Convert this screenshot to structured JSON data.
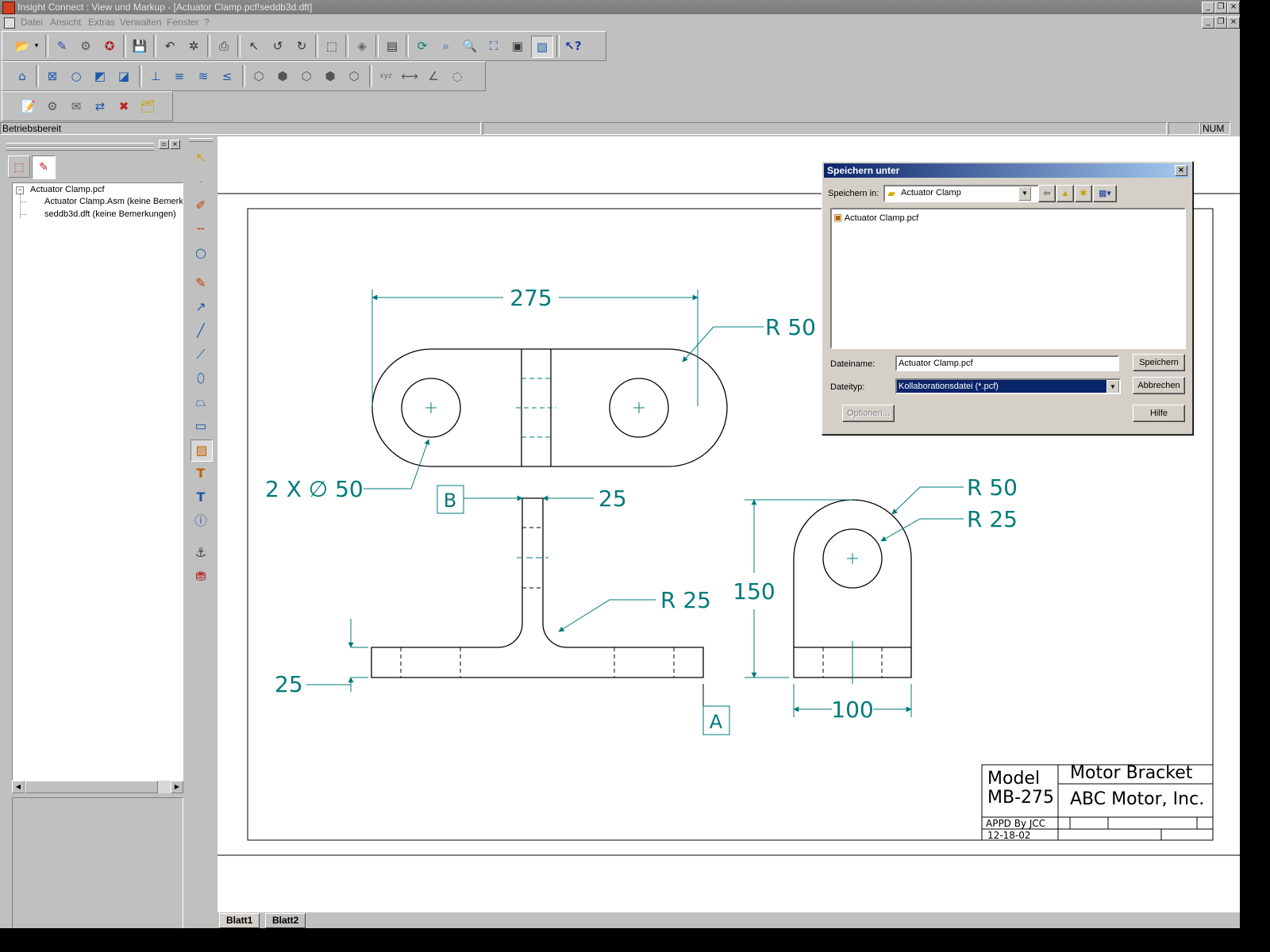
{
  "window": {
    "title": "Insight Connect : View und Markup - [Actuator Clamp.pcf!seddb3d.dft]"
  },
  "menu": [
    "Datei",
    "Ansicht",
    "Extras",
    "Verwalten",
    "Fenster",
    "?"
  ],
  "status": {
    "text": "Betriebsbereit",
    "num": "NUM"
  },
  "tree": {
    "root": "Actuator Clamp.pcf",
    "children": [
      "Actuator Clamp.Asm (keine Bemerkungen)",
      "seddb3d.dft (keine Bemerkungen)"
    ]
  },
  "sheet_tabs": [
    "Blatt1",
    "Blatt2"
  ],
  "drawing": {
    "dims": {
      "top_width": "275",
      "top_radius": "R 50",
      "holes": "2 X ∅ 50",
      "stem_width": "25",
      "datum_b": "B",
      "fillet": "R 25",
      "base_thick": "25",
      "datum_a": "A",
      "side_radius_outer": "R 50",
      "side_radius_inner": "R 25",
      "side_height": "150",
      "side_width": "100"
    },
    "title_block": {
      "model_label": "Model",
      "model_number": "MB-275",
      "part_name": "Motor Bracket",
      "company": "ABC Motor, Inc.",
      "approved": "APPD By JCC",
      "date": "12-18-02"
    },
    "line_color": "#000000",
    "dim_color": "#007a7a"
  },
  "dialog": {
    "title": "Speichern unter",
    "save_in_label": "Speichern in:",
    "save_in_value": "Actuator Clamp",
    "files": [
      "Actuator Clamp.pcf"
    ],
    "filename_label": "Dateiname:",
    "filename_value": "Actuator Clamp.pcf",
    "filetype_label": "Dateityp:",
    "filetype_value": "Kollaborationsdatei (*.pcf)",
    "save_button": "Speichern",
    "cancel_button": "Abbrechen",
    "help_button": "Hilfe",
    "options_button": "Optionen..."
  }
}
